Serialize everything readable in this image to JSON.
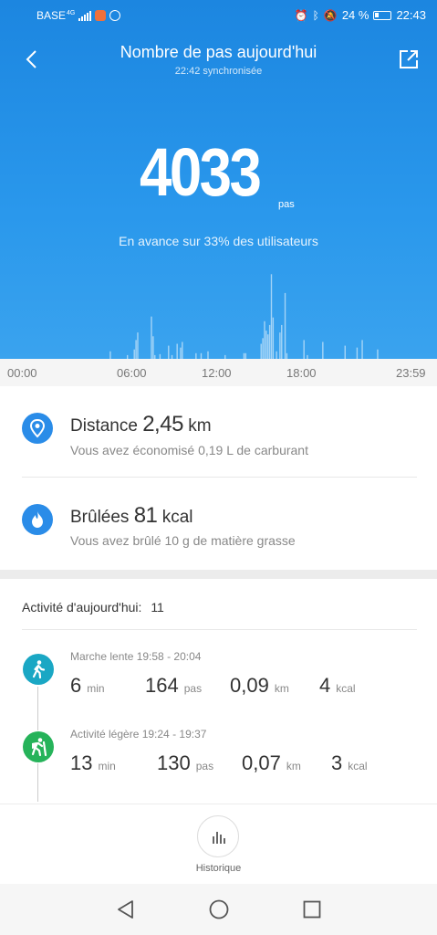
{
  "status_bar": {
    "carrier": "BASE",
    "network": "4G",
    "battery_percent": "24 %",
    "time": "22:43"
  },
  "header": {
    "title": "Nombre de pas aujourd'hui",
    "sync_text": "22:42 synchronisée",
    "back_icon": "chevron-left-icon",
    "share_icon": "share-external-icon"
  },
  "summary": {
    "steps": "4033",
    "steps_unit": "pas",
    "comparison": "En avance sur 33% des utilisateurs"
  },
  "chart_data": {
    "type": "bar",
    "x_ticks": [
      "00:00",
      "06:00",
      "12:00",
      "18:00",
      "23:59"
    ],
    "values": [
      0,
      0,
      0,
      0,
      0,
      0,
      0,
      0,
      0,
      0,
      0,
      0,
      0,
      0,
      0,
      0,
      0,
      0,
      0,
      0,
      0,
      0,
      0,
      0,
      0,
      0,
      0,
      0,
      0,
      0,
      0,
      0,
      0,
      0,
      0,
      0,
      0,
      0,
      0,
      0,
      0,
      0,
      0,
      0,
      0,
      0,
      0,
      0,
      0,
      0,
      0,
      0,
      0,
      0,
      0,
      0,
      0,
      0,
      0,
      0,
      0,
      0,
      0,
      0,
      8,
      0,
      0,
      0,
      0,
      0,
      0,
      0,
      0,
      0,
      4,
      0,
      0,
      0,
      10,
      20,
      28,
      0,
      0,
      0,
      0,
      0,
      0,
      0,
      45,
      24,
      4,
      0,
      0,
      5,
      0,
      0,
      0,
      0,
      14,
      0,
      4,
      0,
      0,
      16,
      0,
      12,
      18,
      0,
      0,
      0,
      0,
      0,
      0,
      0,
      6,
      0,
      0,
      6,
      0,
      0,
      0,
      8,
      0,
      0,
      0,
      0,
      0,
      0,
      0,
      0,
      0,
      4,
      0,
      0,
      0,
      0,
      0,
      0,
      0,
      0,
      0,
      0,
      6,
      6,
      0,
      0,
      0,
      0,
      0,
      0,
      0,
      0,
      16,
      22,
      40,
      30,
      26,
      36,
      90,
      44,
      0,
      8,
      0,
      28,
      36,
      0,
      70,
      6,
      0,
      0,
      0,
      0,
      0,
      0,
      0,
      0,
      0,
      20,
      0,
      4,
      0,
      0,
      0,
      0,
      0,
      0,
      0,
      0,
      18,
      0,
      0,
      0,
      0,
      0,
      0,
      0,
      0,
      0,
      0,
      0,
      0,
      14,
      0,
      0,
      0,
      0,
      0,
      0,
      12,
      0,
      0,
      20,
      0,
      0,
      0,
      0,
      0,
      0,
      0,
      0,
      10,
      0,
      0,
      0,
      0,
      0,
      0,
      0,
      0,
      0,
      0,
      0,
      0,
      0,
      0,
      0,
      0,
      0,
      0,
      0,
      0,
      0,
      0,
      0,
      0,
      0,
      0,
      0,
      0,
      0,
      0,
      0,
      0,
      0,
      0
    ]
  },
  "metrics": [
    {
      "icon": "map-pin-icon",
      "label": "Distance",
      "value": "2,45",
      "unit": "km",
      "detail": "Vous avez économisé 0,19 L de carburant"
    },
    {
      "icon": "flame-icon",
      "label": "Brûlées",
      "value": "81",
      "unit": "kcal",
      "detail": "Vous avez brûlé 10 g de matière grasse"
    }
  ],
  "activity": {
    "heading": "Activité d'aujourd'hui:",
    "count": "11",
    "items": [
      {
        "icon": "walking-person-icon",
        "color": "#1aa7c4",
        "title": "Marche lente 19:58 - 20:04",
        "duration": "6",
        "duration_unit": "min",
        "steps": "164",
        "steps_unit": "pas",
        "distance": "0,09",
        "distance_unit": "km",
        "calories": "4",
        "calories_unit": "kcal"
      },
      {
        "icon": "hiking-person-icon",
        "color": "#26b35a",
        "title": "Activité légère 19:24 - 19:37",
        "duration": "13",
        "duration_unit": "min",
        "steps": "130",
        "steps_unit": "pas",
        "distance": "0,07",
        "distance_unit": "km",
        "calories": "3",
        "calories_unit": "kcal"
      }
    ]
  },
  "history_button": {
    "label": "Historique",
    "icon": "bar-chart-icon"
  },
  "navigation": {
    "back_icon": "triangle-back-icon",
    "home_icon": "circle-home-icon",
    "recents_icon": "square-recents-icon"
  },
  "colors": {
    "header_blue": "#1c86e0",
    "accent_blue": "#2a8ce8",
    "walk_teal": "#1aa7c4",
    "light_green": "#26b35a"
  }
}
